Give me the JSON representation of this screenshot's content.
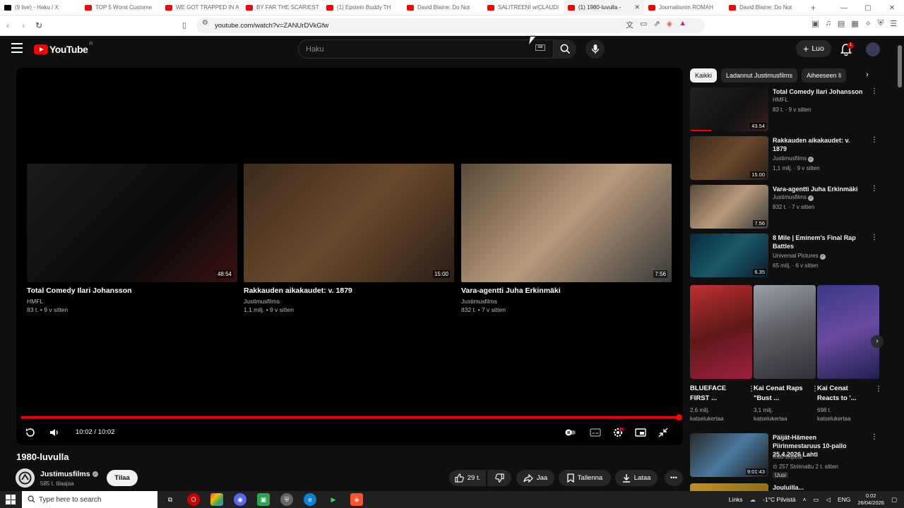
{
  "browser": {
    "tabs": [
      {
        "label": "(9 live) - Haku / X",
        "kind": "x"
      },
      {
        "label": "TOP 5 Worst Custome",
        "kind": "yt"
      },
      {
        "label": "WE GOT TRAPPED IN A",
        "kind": "yt"
      },
      {
        "label": "BY FAR THE SCARIEST",
        "kind": "yt"
      },
      {
        "label": "(1) Epstein Buddy TH",
        "kind": "yt"
      },
      {
        "label": "David Blaine: Do Not",
        "kind": "yt"
      },
      {
        "label": "SALITREENI w/CLAUDI",
        "kind": "yt"
      },
      {
        "label": "(1) 1980-luvulla -",
        "kind": "yt",
        "active": true
      },
      {
        "label": "Journalismin ROMAH",
        "kind": "yt"
      },
      {
        "label": "David Blaine: Do Not",
        "kind": "yt"
      }
    ],
    "new_tab": "+",
    "url": "youtube.com/watch?v=ZANUrDVkGfw"
  },
  "header": {
    "logo_text": "YouTube",
    "logo_country": "FI",
    "search_placeholder": "Haku",
    "create_label": "Luo",
    "notif_count": "1"
  },
  "player": {
    "endcards": [
      {
        "title": "Total Comedy Ilari Johansson",
        "channel": "HMFL",
        "meta": "83 t. • 9 v sitten",
        "duration": "48:54",
        "bg": "linear-gradient(135deg,#1a1a1a,#0b0b0b 60%,#3a1010)"
      },
      {
        "title": "Rakkauden aikakaudet: v. 1879",
        "channel": "Justimusfilms",
        "meta": "1,1 milj. • 9 v sitten",
        "duration": "15:00",
        "bg": "linear-gradient(135deg,#3b2a1c,#6b4a2c 50%,#2a1f16)"
      },
      {
        "title": "Vara-agentti Juha Erkinmäki",
        "channel": "Justimusfilms",
        "meta": "832 t. • 7 v sitten",
        "duration": "7:56",
        "bg": "linear-gradient(135deg,#5a4a3a,#b89a7a 50%,#3a3a3a)"
      }
    ],
    "progress": 1.0,
    "time": "10:02 / 10:02"
  },
  "video": {
    "title": "1980-luvulla",
    "channel": "Justimusfilms",
    "subs": "585 t. tilaajaa",
    "subscribe": "Tilaa",
    "likes": "29 t.",
    "share": "Jaa",
    "save": "Tallenna",
    "download": "Lataa"
  },
  "sidebar": {
    "chips": [
      "Kaikki",
      "Ladannut Justimusfilms",
      "Aiheeseen li"
    ],
    "recs": [
      {
        "title": "Total Comedy Ilari Johansson",
        "channel": "HMFL",
        "meta": "83 t. · 9 v sitten",
        "duration": "43.54",
        "verified": false,
        "bg": "linear-gradient(135deg,#222,#111 60%,#402020)",
        "watched": true
      },
      {
        "title": "Rakkauden aikakaudet: v. 1879",
        "channel": "Justimusfilms",
        "meta": "1,1 milj. · 9 v sitten",
        "duration": "15.00",
        "verified": true,
        "bg": "linear-gradient(135deg,#3b2a1c,#6b4a2c 50%,#2a1f16)",
        "watched": false
      },
      {
        "title": "Vara-agentti Juha Erkinmäki",
        "channel": "Justimusfilms",
        "meta": "832 t. · 7 v sitten",
        "duration": "7.56",
        "verified": true,
        "bg": "linear-gradient(135deg,#5a4a3a,#b89a7a 50%,#3a3a3a)",
        "watched": false
      },
      {
        "title": "8 Mile | Eminem's Final Rap Battles",
        "channel": "Universal Pictures",
        "meta": "65 milj. · 6 v sitten",
        "duration": "6.35",
        "verified": true,
        "bg": "linear-gradient(135deg,#0a2a3a,#1a5a6a 50%,#0a1a2a)",
        "watched": false
      }
    ],
    "shorts": [
      {
        "title": "BLUEFACE FIRST ...",
        "views1": "2,6 milj.",
        "views2": "katselukertaa",
        "bg": "linear-gradient(160deg,#c03030,#601818 50%,#a02040)"
      },
      {
        "title": "Kai Cenat Raps \"Bust ...",
        "views1": "3,1 milj.",
        "views2": "katselukertaa",
        "bg": "linear-gradient(160deg,#9aa0a8,#5a5a60 50%,#303038)"
      },
      {
        "title": "Kai Cenat Reacts to '...",
        "views1": "698 t.",
        "views2": "katselukertaa",
        "bg": "linear-gradient(160deg,#3a3a8a,#6a4aa0 50%,#202050)"
      }
    ],
    "rec5": {
      "title": "Päijät-Hämeen Piirinmestaruus 10-pallo 25.4.2026 Lahti",
      "channel": "Kasi-Biljardi",
      "meta": "257 Striimattu 2 t. sitten",
      "badge": "Uusi",
      "duration": "9:01:43",
      "bg": "linear-gradient(135deg,#2a2a2a,#4a7aa0 50%,#1a1a1a)"
    },
    "rec6": {
      "title": "Jouluilla...",
      "bg": "linear-gradient(135deg,#c09020,#806010)"
    }
  },
  "taskbar": {
    "search_placeholder": "Type here to search",
    "links": "Links",
    "weather": "-1°C  Pilvistä",
    "lang": "ENG",
    "time": "0.02",
    "date": "26/04/2026"
  }
}
